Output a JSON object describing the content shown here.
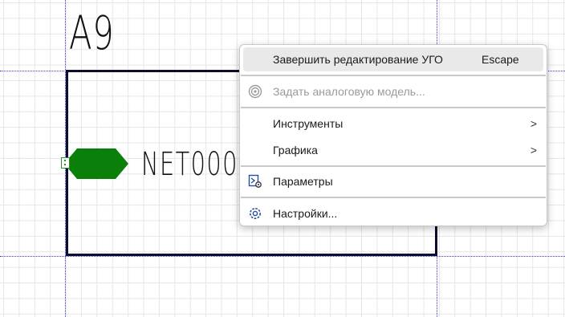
{
  "schematic": {
    "designator": "A9",
    "net_label": "NET0003",
    "port_color": "#0a7f0a",
    "body_border_color": "#0d0d2e",
    "guide_color": "#3a3ad8"
  },
  "context_menu": {
    "items": [
      {
        "label": "Завершить редактирование УГО",
        "shortcut": "Escape",
        "state": "highlighted"
      },
      {
        "label": "Задать аналоговую модель...",
        "icon": "analog-model-icon",
        "state": "disabled"
      },
      {
        "label": "Инструменты",
        "submenu_icon": "chevron-right-icon"
      },
      {
        "label": "Графика",
        "submenu_icon": "chevron-right-icon"
      },
      {
        "label": "Параметры",
        "icon": "parameters-icon"
      },
      {
        "label": "Настройки...",
        "icon": "gear-icon"
      }
    ],
    "arrow_glyph": ">"
  }
}
